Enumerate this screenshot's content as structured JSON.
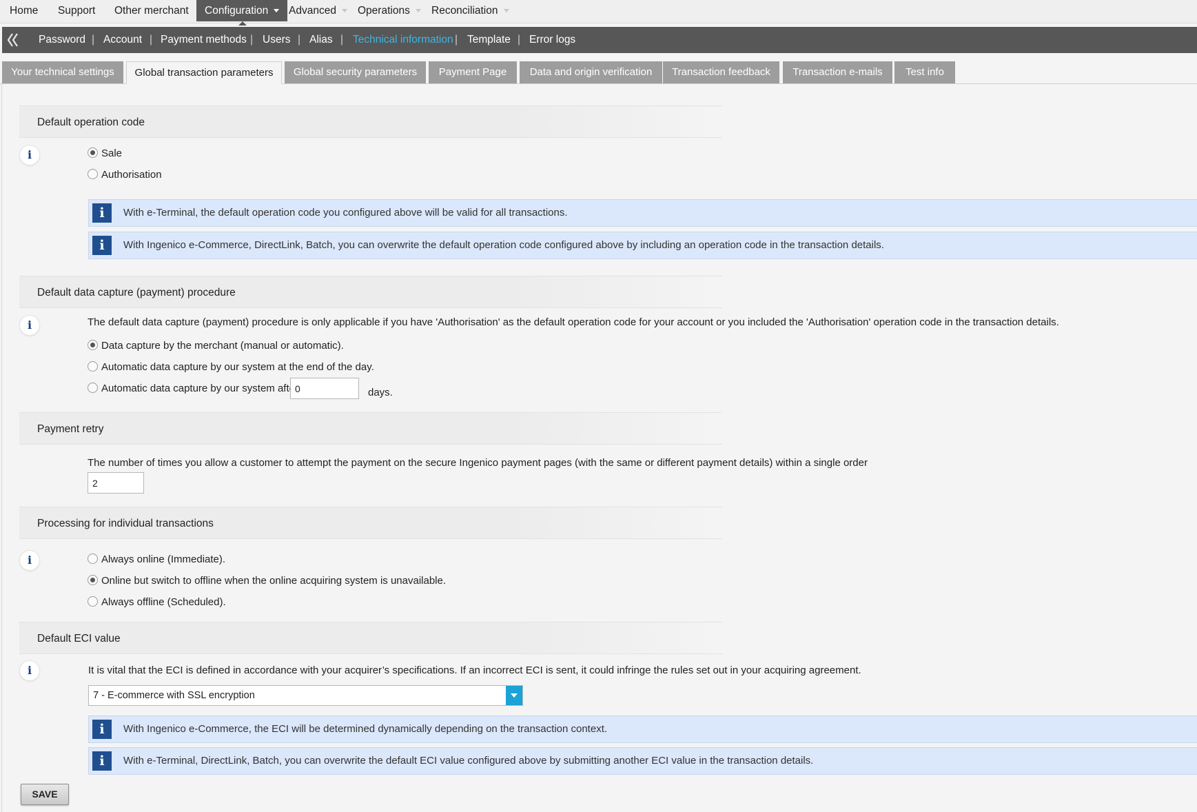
{
  "topnav": {
    "items": [
      {
        "label": "Home",
        "has_caret": false
      },
      {
        "label": "Support",
        "has_caret": false
      },
      {
        "label": "Other merchant",
        "has_caret": false
      },
      {
        "label": "Configuration",
        "has_caret": true,
        "active": true
      },
      {
        "label": "Advanced",
        "has_caret": true
      },
      {
        "label": "Operations",
        "has_caret": true
      },
      {
        "label": "Reconciliation",
        "has_caret": true
      }
    ]
  },
  "subnav": {
    "collapse_icon": "double-chevron-left-icon",
    "items": [
      {
        "label": "Password"
      },
      {
        "label": "Account"
      },
      {
        "label": "Payment methods"
      },
      {
        "label": "Users"
      },
      {
        "label": "Alias"
      },
      {
        "label": "Technical information",
        "active": true
      },
      {
        "label": "Template"
      },
      {
        "label": "Error logs"
      }
    ],
    "separator": "|",
    "active_color": "#3fb5e2"
  },
  "tabs": [
    {
      "label": "Your technical settings"
    },
    {
      "label": "Global transaction parameters",
      "active": true
    },
    {
      "label": "Global security parameters"
    },
    {
      "label": "Payment Page"
    },
    {
      "label": "Data and origin verification"
    },
    {
      "label": "Transaction feedback"
    },
    {
      "label": "Transaction e-mails"
    },
    {
      "label": "Test info"
    }
  ],
  "info_glyph": "i",
  "sections": {
    "operation_code": {
      "title": "Default operation code",
      "options": [
        {
          "label": "Sale",
          "checked": true
        },
        {
          "label": "Authorisation",
          "checked": false
        }
      ],
      "notices": [
        "With e-Terminal, the default operation code you configured above will be valid for all transactions.",
        "With Ingenico e-Commerce, DirectLink, Batch, you can overwrite the default operation code configured above by including an operation code in the transaction details."
      ]
    },
    "data_capture": {
      "title": "Default data capture (payment) procedure",
      "description": "The default data capture (payment) procedure is only applicable if you have 'Authorisation' as the default operation code for your account or you included the 'Authorisation' operation code in the transaction details.",
      "options": [
        {
          "label": "Data capture by the merchant (manual or automatic).",
          "checked": true
        },
        {
          "label": "Automatic data capture by our system at the end of the day.",
          "checked": false
        },
        {
          "label": "Automatic data capture by our system after",
          "checked": false
        }
      ],
      "days_value": "0",
      "days_suffix": "days."
    },
    "payment_retry": {
      "title": "Payment retry",
      "description": "The number of times you allow a customer to attempt the payment on the secure Ingenico payment pages (with the same or different payment details) within a single order",
      "value": "2"
    },
    "processing": {
      "title": "Processing for individual transactions",
      "options": [
        {
          "label": "Always online (Immediate).",
          "checked": false
        },
        {
          "label": "Online but switch to offline when the online acquiring system is unavailable.",
          "checked": true
        },
        {
          "label": "Always offline (Scheduled).",
          "checked": false
        }
      ]
    },
    "eci": {
      "title": "Default ECI value",
      "description": "It is vital that the ECI is defined in accordance with your acquirer’s specifications. If an incorrect ECI is sent, it could infringe the rules set out in your acquiring agreement.",
      "selected": "7 - E-commerce with SSL encryption",
      "notices": [
        "With Ingenico e-Commerce, the ECI will be determined dynamically depending on the transaction context.",
        "With e-Terminal, DirectLink, Batch, you can overwrite the default ECI value configured above by submitting another ECI value in the transaction details."
      ]
    }
  },
  "save_label": "SAVE",
  "colors": {
    "topnav_active_bg": "#5a5a5a",
    "subnav_bg": "#575757",
    "tab_bg": "#9d9d9d",
    "notice_bg": "#dbe7fb",
    "notice_icon_bg": "#1f4f8f",
    "select_button": "#1ba2d6"
  }
}
